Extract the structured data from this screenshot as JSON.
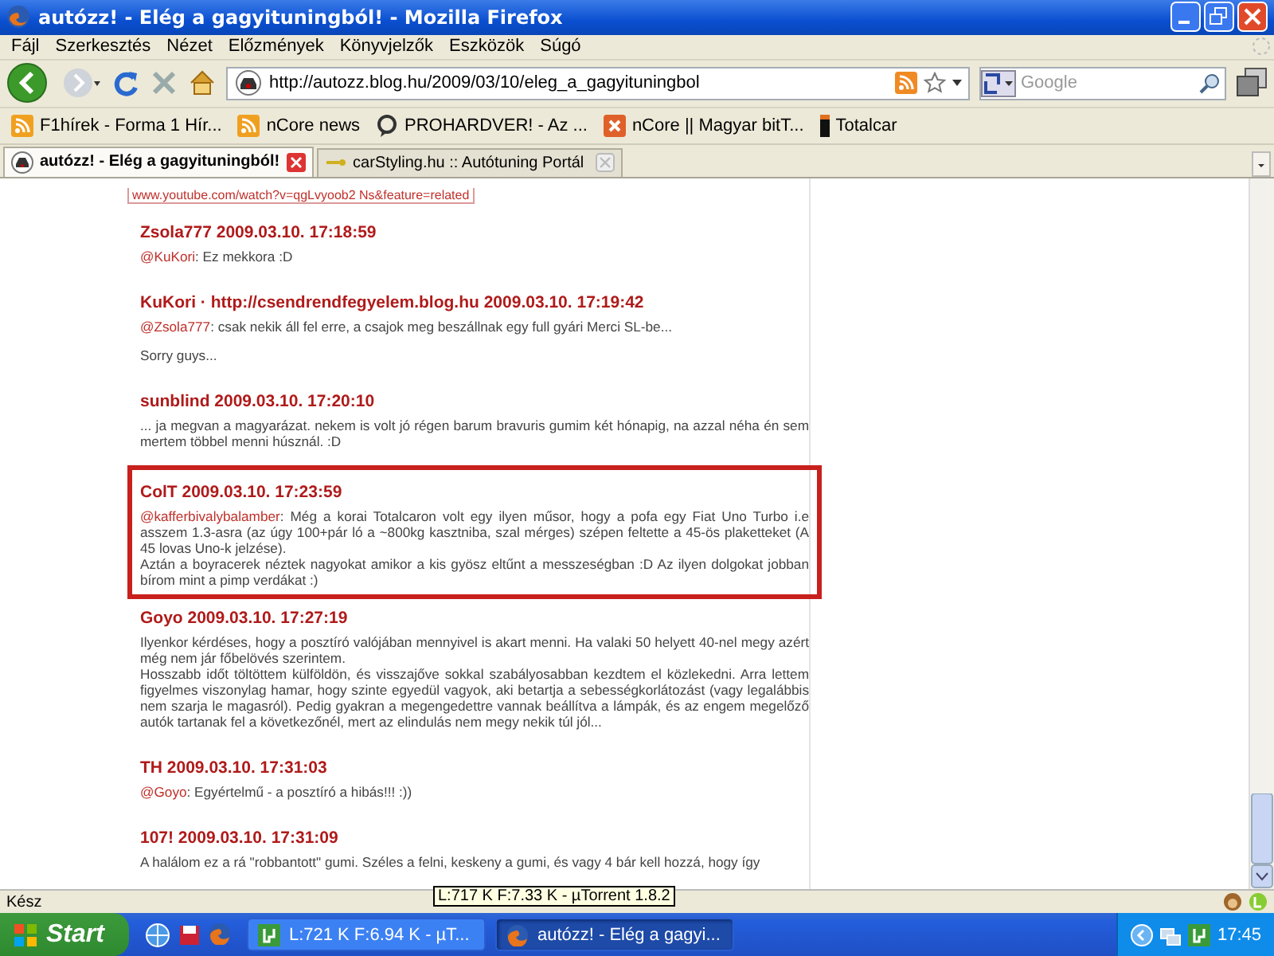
{
  "window": {
    "title": "autózz! - Elég a gagyituningból! - Mozilla Firefox"
  },
  "menu": [
    "Fájl",
    "Szerkesztés",
    "Nézet",
    "Előzmények",
    "Könyvjelzők",
    "Eszközök",
    "Súgó"
  ],
  "address": {
    "value": "http://autozz.blog.hu/2009/03/10/eleg_a_gagyituningbol"
  },
  "search": {
    "placeholder": "Google"
  },
  "bookmarks": [
    {
      "label": "F1hírek - Forma 1 Hír...",
      "kind": "feed"
    },
    {
      "label": "nCore news",
      "kind": "feed"
    },
    {
      "label": "PROHARDVER! - Az ...",
      "kind": "site"
    },
    {
      "label": "nCore || Magyar bitT...",
      "kind": "x"
    },
    {
      "label": "Totalcar",
      "kind": "bar"
    }
  ],
  "tabs": [
    {
      "label": "autózz! - Elég a gagyituningból!",
      "selected": true
    },
    {
      "label": "carStyling.hu :: Autótuning Portál",
      "selected": false
    }
  ],
  "top_link": "www.youtube.com/watch?v=qgLvyoob2 Ns&feature=related",
  "comments": [
    {
      "heading": "Zsola777 2009.03.10. 17:18:59",
      "highlighted": false,
      "paragraphs": [
        {
          "reply_to": "@KuKori",
          "text": ": Ez mekkora :D"
        }
      ]
    },
    {
      "heading": "KuKori · http://csendrendfegyelem.blog.hu 2009.03.10. 17:19:42",
      "highlighted": false,
      "paragraphs": [
        {
          "reply_to": "@Zsola777",
          "text": ": csak nekik áll fel erre, a csajok meg beszállnak egy full gyári Merci SL-be..."
        },
        {
          "text": "Sorry guys..."
        }
      ]
    },
    {
      "heading": "sunblind 2009.03.10. 17:20:10",
      "highlighted": false,
      "paragraphs": [
        {
          "text": "... ja megvan a magyarázat. nekem is volt jó régen barum bravuris gumim két hónapig, na azzal néha én sem mertem többel menni húsznál. :D"
        }
      ]
    },
    {
      "heading": "ColT 2009.03.10. 17:23:59",
      "highlighted": true,
      "paragraphs": [
        {
          "reply_to": "@kafferbivalybalamber",
          "text": ": Még a korai Totalcaron volt egy ilyen műsor, hogy a pofa egy Fiat Uno Turbo i.e asszem 1.3-asra (az úgy 100+pár ló a ~800kg kasztniba, szal mérges) szépen feltette a 45-ös plaketteket (A 45 lovas Uno-k jelzése).\nAztán a boyracerek néztek nagyokat amikor a kis gyösz eltűnt a messzeségban :D Az ilyen dolgokat jobban bírom mint a pimp verdákat :)"
        }
      ]
    },
    {
      "heading": "Goyo 2009.03.10. 17:27:19",
      "highlighted": false,
      "paragraphs": [
        {
          "text": "Ilyenkor kérdéses, hogy a posztíró valójában mennyivel is akart menni. Ha valaki 50 helyett 40-nel megy azért még nem jár főbelövés szerintem.\nHosszabb időt töltöttem külföldön, és visszajőve sokkal szabályosabban kezdtem el közlekedni. Arra lettem figyelmes viszonylag hamar, hogy szinte egyedül vagyok, aki betartja a sebességkorlátozást (vagy legalábbis nem szarja le magasról). Pedig gyakran a megengedettre vannak beállítva a lámpák, és az engem megelőző autók tartanak fel a következőnél, mert az elindulás nem megy nekik túl jól..."
        }
      ]
    },
    {
      "heading": "TH 2009.03.10. 17:31:03",
      "highlighted": false,
      "paragraphs": [
        {
          "reply_to": "@Goyo",
          "text": ": Egyértelmű - a posztíró a hibás!!! :))"
        }
      ]
    },
    {
      "heading": "107! 2009.03.10. 17:31:09",
      "highlighted": false,
      "paragraphs": [
        {
          "text": "A halálom ez a rá \"robbantott\" gumi. Széles a felni, keskeny a gumi, és vagy 4 bár kell hozzá, hogy így"
        }
      ]
    }
  ],
  "status_bar": {
    "text": "Kész",
    "tooltip": "L:717 K F:7.33 K - µTorrent 1.8.2"
  },
  "taskbar": {
    "start": "Start",
    "tasks": [
      {
        "label": "L:721 K F:6.94 K - µT...",
        "kind": "torrent",
        "selected": false
      },
      {
        "label": "autózz! - Elég a gagyi...",
        "kind": "firefox",
        "selected": true
      }
    ],
    "clock": "17:45"
  }
}
